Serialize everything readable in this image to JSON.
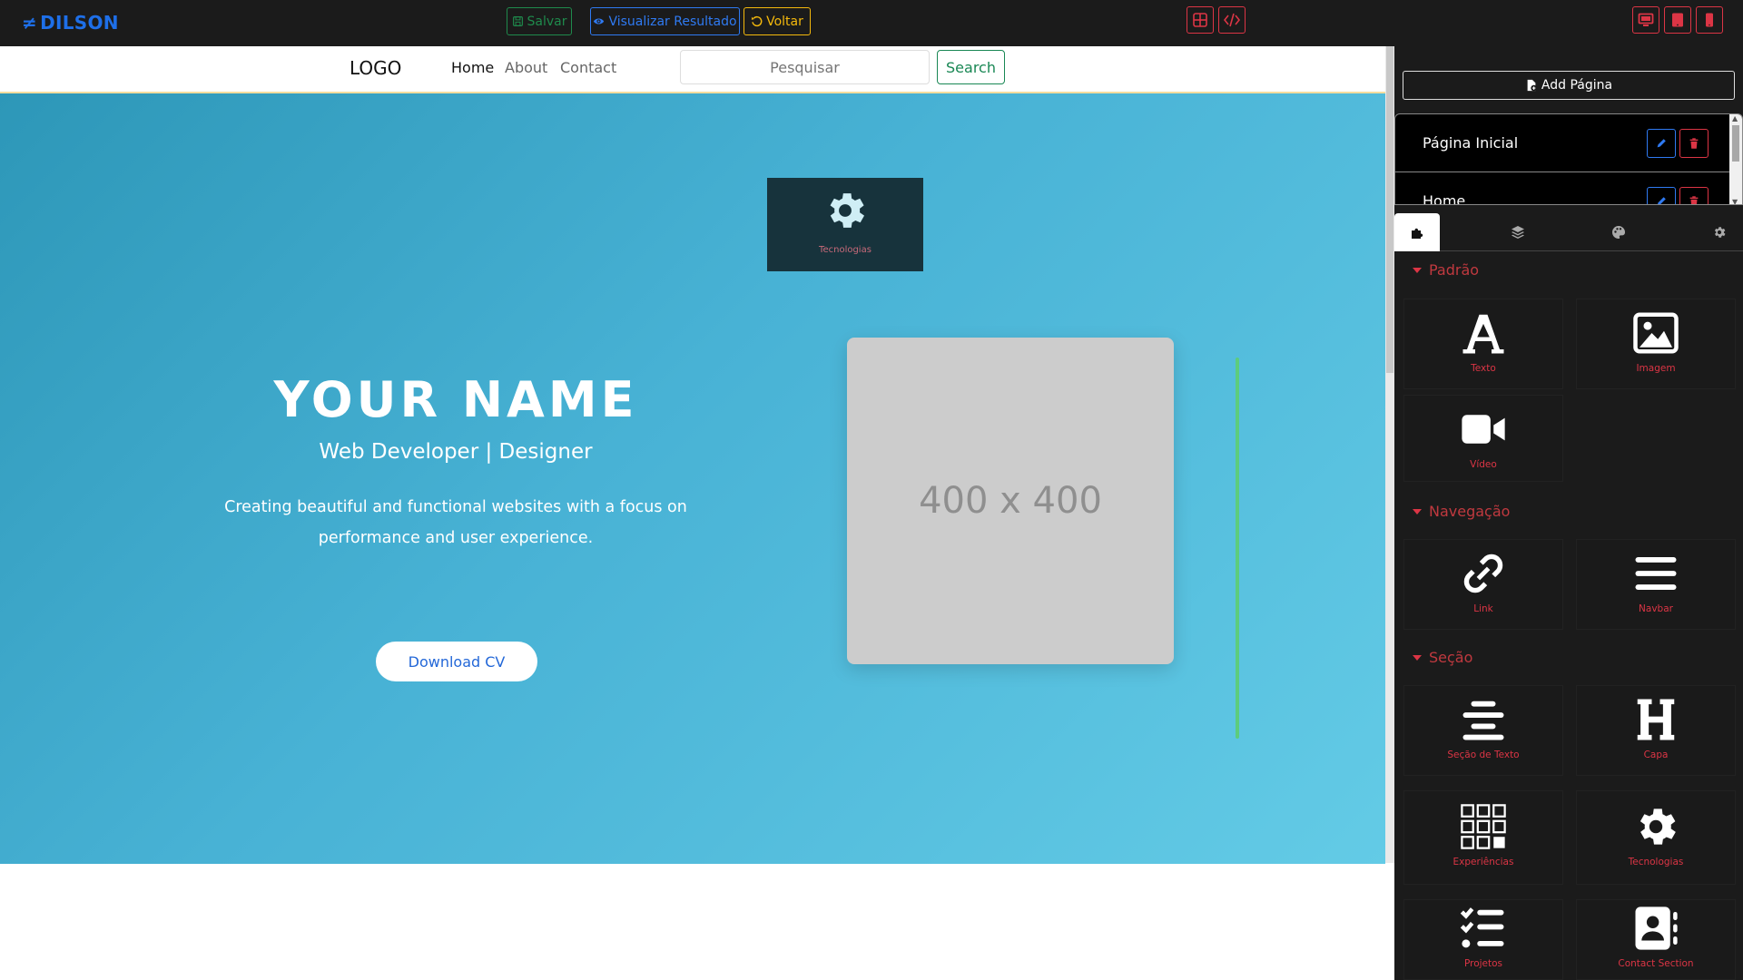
{
  "toolbar": {
    "brand": "DILSON",
    "salvar": "Salvar",
    "visualizar": "Visualizar Resultado",
    "voltar": "Voltar",
    "icons": [
      "layout-grid-icon",
      "code-icon",
      "desktop-icon",
      "tablet-icon",
      "mobile-icon"
    ]
  },
  "preview": {
    "navbar": {
      "logo": "LOGO",
      "links": [
        "Home",
        "About",
        "Contact"
      ],
      "search_placeholder": "Pesquisar",
      "search_button": "Search"
    },
    "tech_card_label": "Tecnologias",
    "hero": {
      "name": "YOUR NAME",
      "subtitle": "Web Developer | Designer",
      "description": "Creating beautiful and functional websites with a focus on performance and user experience.",
      "button": "Download CV",
      "image_placeholder": "400 x 400"
    }
  },
  "panel": {
    "add_page": "Add Página",
    "pages": [
      "Página Inicial",
      "Home"
    ],
    "tabs": [
      "components-icon",
      "layers-icon",
      "palette-icon",
      "settings-icon"
    ],
    "sections": [
      {
        "title": "Padrão",
        "blocks": [
          "Texto",
          "Imagem",
          "Vídeo"
        ]
      },
      {
        "title": "Navegação",
        "blocks": [
          "Link",
          "Navbar"
        ]
      },
      {
        "title": "Seção",
        "blocks": [
          "Seção de Texto",
          "Capa",
          "Experiências",
          "Tecnologias",
          "Projetos",
          "Contact Section"
        ]
      }
    ]
  },
  "colors": {
    "toolbar_bg": "#1b1b1b",
    "brand": "#1e6fe8",
    "danger": "#dc3545",
    "hero_gradient_start": "#2d97b8",
    "hero_gradient_end": "#63cbe6"
  }
}
